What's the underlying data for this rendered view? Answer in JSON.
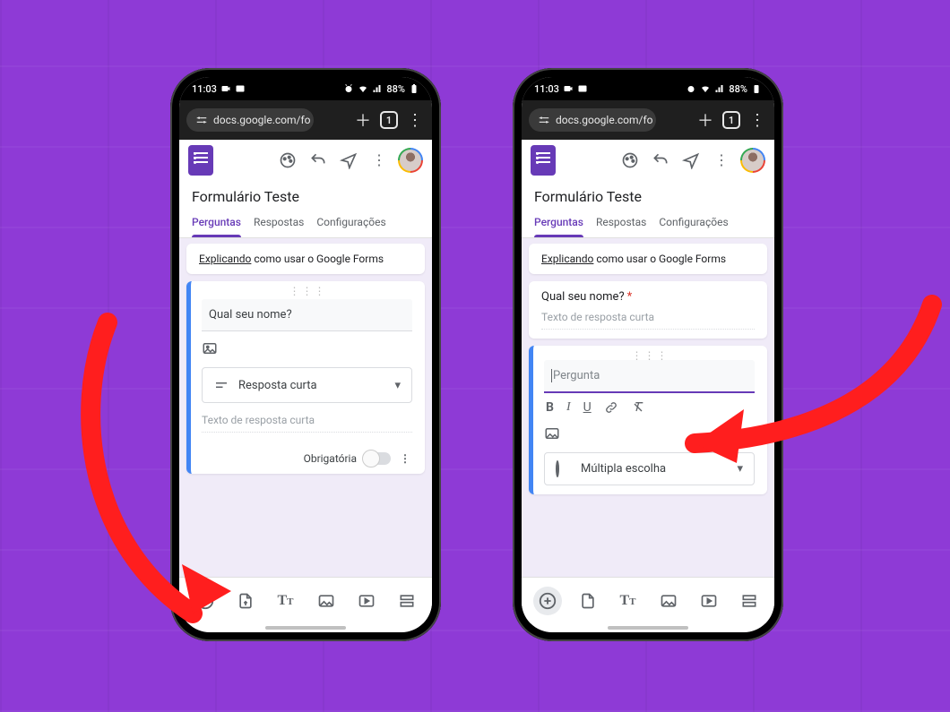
{
  "statusbar": {
    "time": "11:03",
    "battery": "88%"
  },
  "browser": {
    "url": "docs.google.com/fo",
    "tab_count": "1"
  },
  "form": {
    "title": "Formulário Teste",
    "tabs": {
      "questions": "Perguntas",
      "responses": "Respostas",
      "settings": "Configurações"
    },
    "description_underlined": "Explicando",
    "description_rest": " como usar o Google Forms"
  },
  "left_phone": {
    "question_title": "Qual seu nome?",
    "answer_type": "Resposta curta",
    "answer_placeholder": "Texto de resposta curta",
    "required_label": "Obrigatória"
  },
  "right_phone": {
    "prev_question": "Qual seu nome?",
    "prev_answer_placeholder": "Texto de resposta curta",
    "new_question_placeholder": "Pergunta",
    "answer_type": "Múltipla escolha"
  }
}
